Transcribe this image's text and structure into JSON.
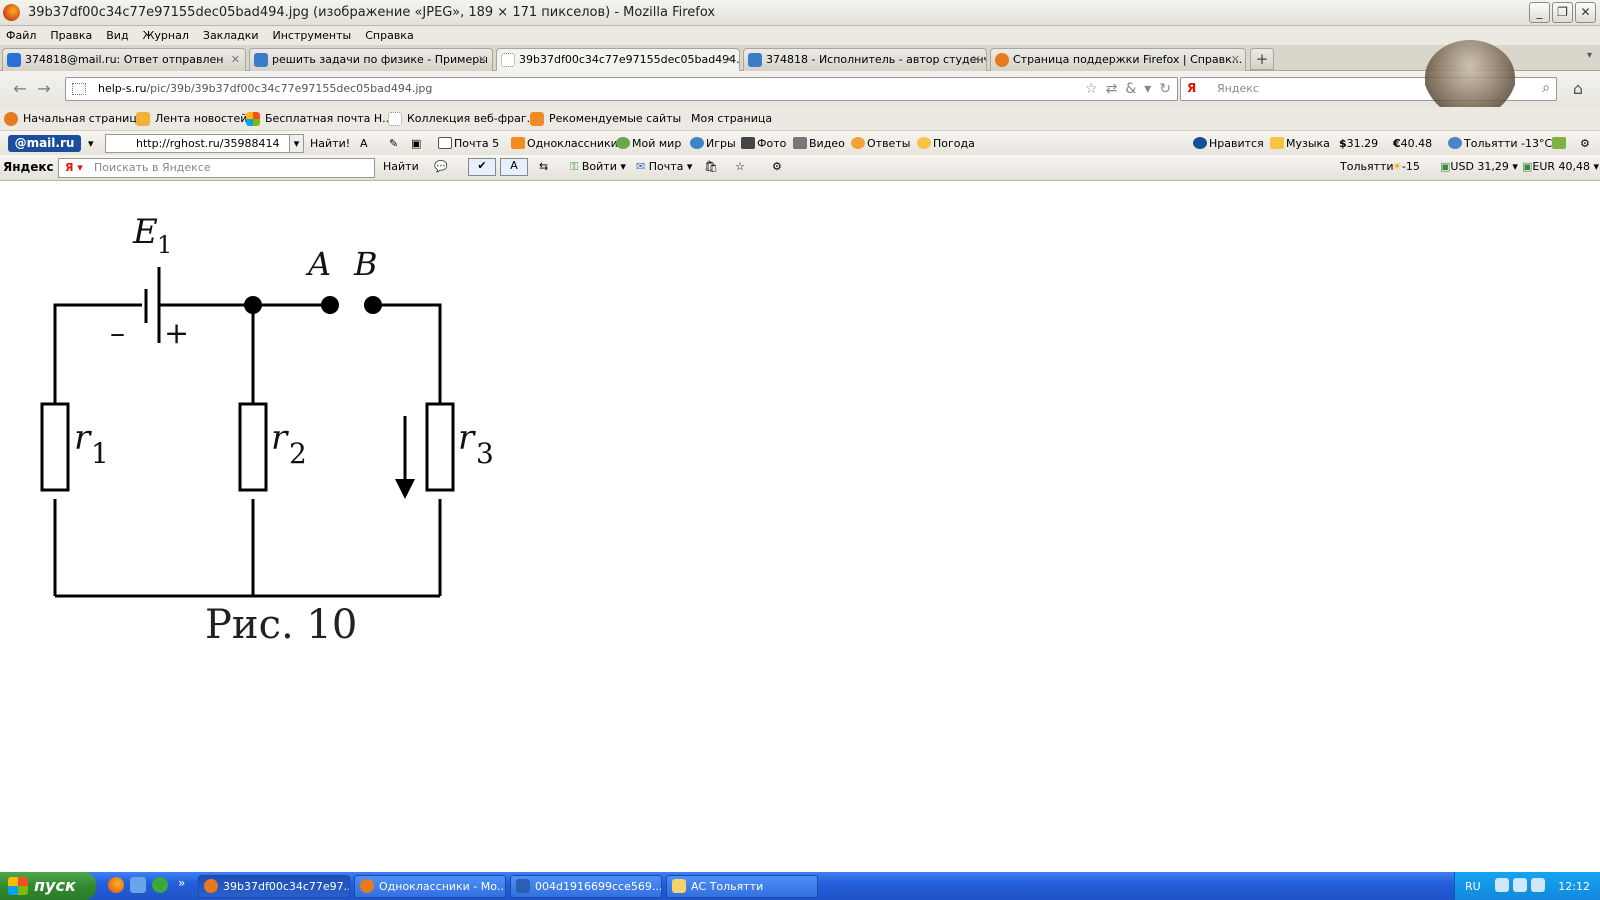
{
  "window": {
    "title": "39b37df00c34c77e97155dec05bad494.jpg (изображение «JPEG», 189 × 171 пикселов) - Mozilla Firefox",
    "minimize": "_",
    "maximize": "❐",
    "close": "✕"
  },
  "menu": [
    "Файл",
    "Правка",
    "Вид",
    "Журнал",
    "Закладки",
    "Инструменты",
    "Справка"
  ],
  "tabs": [
    {
      "label": "374818@mail.ru: Ответ отправлен",
      "icon_color": "#2a6fd6"
    },
    {
      "label": "решить задачи по физике - Примеры - ...",
      "icon_color": "#3b7bc9"
    },
    {
      "label": "39b37df00c34c77e97155dec05bad494.j...",
      "icon_color": "#ffffff",
      "active": true
    },
    {
      "label": "374818 - Исполнитель - автор студенч...",
      "icon_color": "#3b7bc9"
    },
    {
      "label": "Страница поддержки Firefox | Справк...",
      "icon_color": "#e87a1e"
    }
  ],
  "new_tab_label": "+",
  "nav": {
    "back": "←",
    "forward": "→",
    "url_host": "help-s.ru",
    "url_path": "/pic/39b/39b37df00c34c77e97155dec05bad494.jpg",
    "search_placeholder": "Яндекс",
    "home": "⌂"
  },
  "bookmarks": [
    "Начальная страница",
    "Лента новостей",
    "Бесплатная почта Н...",
    "Коллекция веб-фраг...",
    "Рекомендуемые сайты",
    "Моя страница"
  ],
  "mailru_bar": {
    "logo": "@mail.ru",
    "url_value": "http://rghost.ru/35988414",
    "find_button": "Найти!",
    "items": [
      "Почта 5",
      "Одноклассники",
      "Мой мир",
      "Игры",
      "Фото",
      "Видео",
      "Ответы",
      "Погода"
    ],
    "right_items": [
      "Нравится",
      "Музыка",
      "31.29",
      "40.48",
      "Тольятти -13°C"
    ]
  },
  "yandex_bar": {
    "logo": "Яндекс",
    "search_placeholder": "Поискать в Яндексе",
    "find_button": "Найти",
    "login": "Войти",
    "mail": "Почта",
    "city": "Тольятти",
    "temp": "-15",
    "usd": "USD 31,29",
    "eur": "EUR 40,48"
  },
  "figure": {
    "emf_label": "E",
    "emf_sub": "1",
    "minus": "–",
    "plus": "+",
    "terminal_a": "A",
    "terminal_b": "B",
    "r1_label": "r",
    "r1_sub": "1",
    "r2_label": "r",
    "r2_sub": "2",
    "r3_label": "r",
    "r3_sub": "3",
    "caption": "Рис. 10"
  },
  "taskbar": {
    "start": "пуск",
    "tasks": [
      {
        "label": "39b37df00c34c77e97...",
        "icon_color": "#e87a1e",
        "active": true
      },
      {
        "label": "Одноклассники - Мо...",
        "icon_color": "#e87a1e"
      },
      {
        "label": "004d1916699cce569...",
        "icon_color": "#2b5fb3"
      },
      {
        "label": "АС Тольятти",
        "icon_color": "#f4d36a"
      }
    ],
    "lang": "RU",
    "clock": "12:12"
  }
}
